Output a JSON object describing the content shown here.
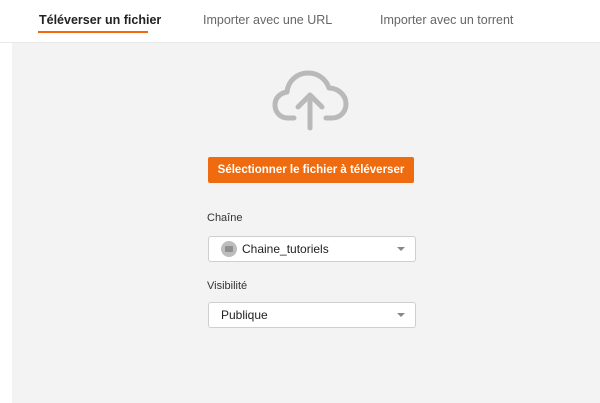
{
  "tabs": [
    {
      "label": "Téléverser un fichier",
      "active": true
    },
    {
      "label": "Importer avec une URL",
      "active": false
    },
    {
      "label": "Importer avec un torrent",
      "active": false
    }
  ],
  "upload": {
    "icon": "cloud-upload-icon",
    "button_label": "Sélectionner le fichier à téléverser"
  },
  "channel": {
    "label": "Chaîne",
    "value": "Chaine_tutoriels"
  },
  "visibility": {
    "label": "Visibilité",
    "value": "Publique"
  },
  "colors": {
    "accent": "#ef6b0f",
    "panel_background": "#f3f3f3"
  }
}
